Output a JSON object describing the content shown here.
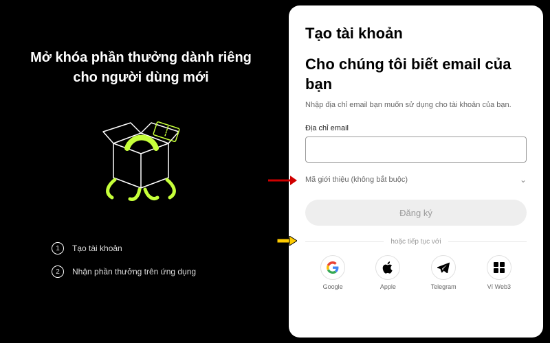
{
  "left": {
    "title": "Mở khóa phần thưởng dành riêng cho người dùng mới",
    "steps": [
      {
        "num": "1",
        "label": "Tạo tài khoản"
      },
      {
        "num": "2",
        "label": "Nhận phần thưởng trên ứng dụng"
      }
    ]
  },
  "card": {
    "heading": "Tạo tài khoản",
    "question": "Cho chúng tôi biết email của bạn",
    "helper": "Nhập địa chỉ email bạn muốn sử dụng cho tài khoản của bạn.",
    "email_label": "Địa chỉ email",
    "email_value": "",
    "referral_label": "Mã giới thiệu (không bắt buộc)",
    "signup_label": "Đăng ký",
    "divider_text": "hoặc tiếp tục với",
    "social": [
      {
        "name": "Google"
      },
      {
        "name": "Apple"
      },
      {
        "name": "Telegram"
      },
      {
        "name": "Ví Web3"
      }
    ]
  }
}
